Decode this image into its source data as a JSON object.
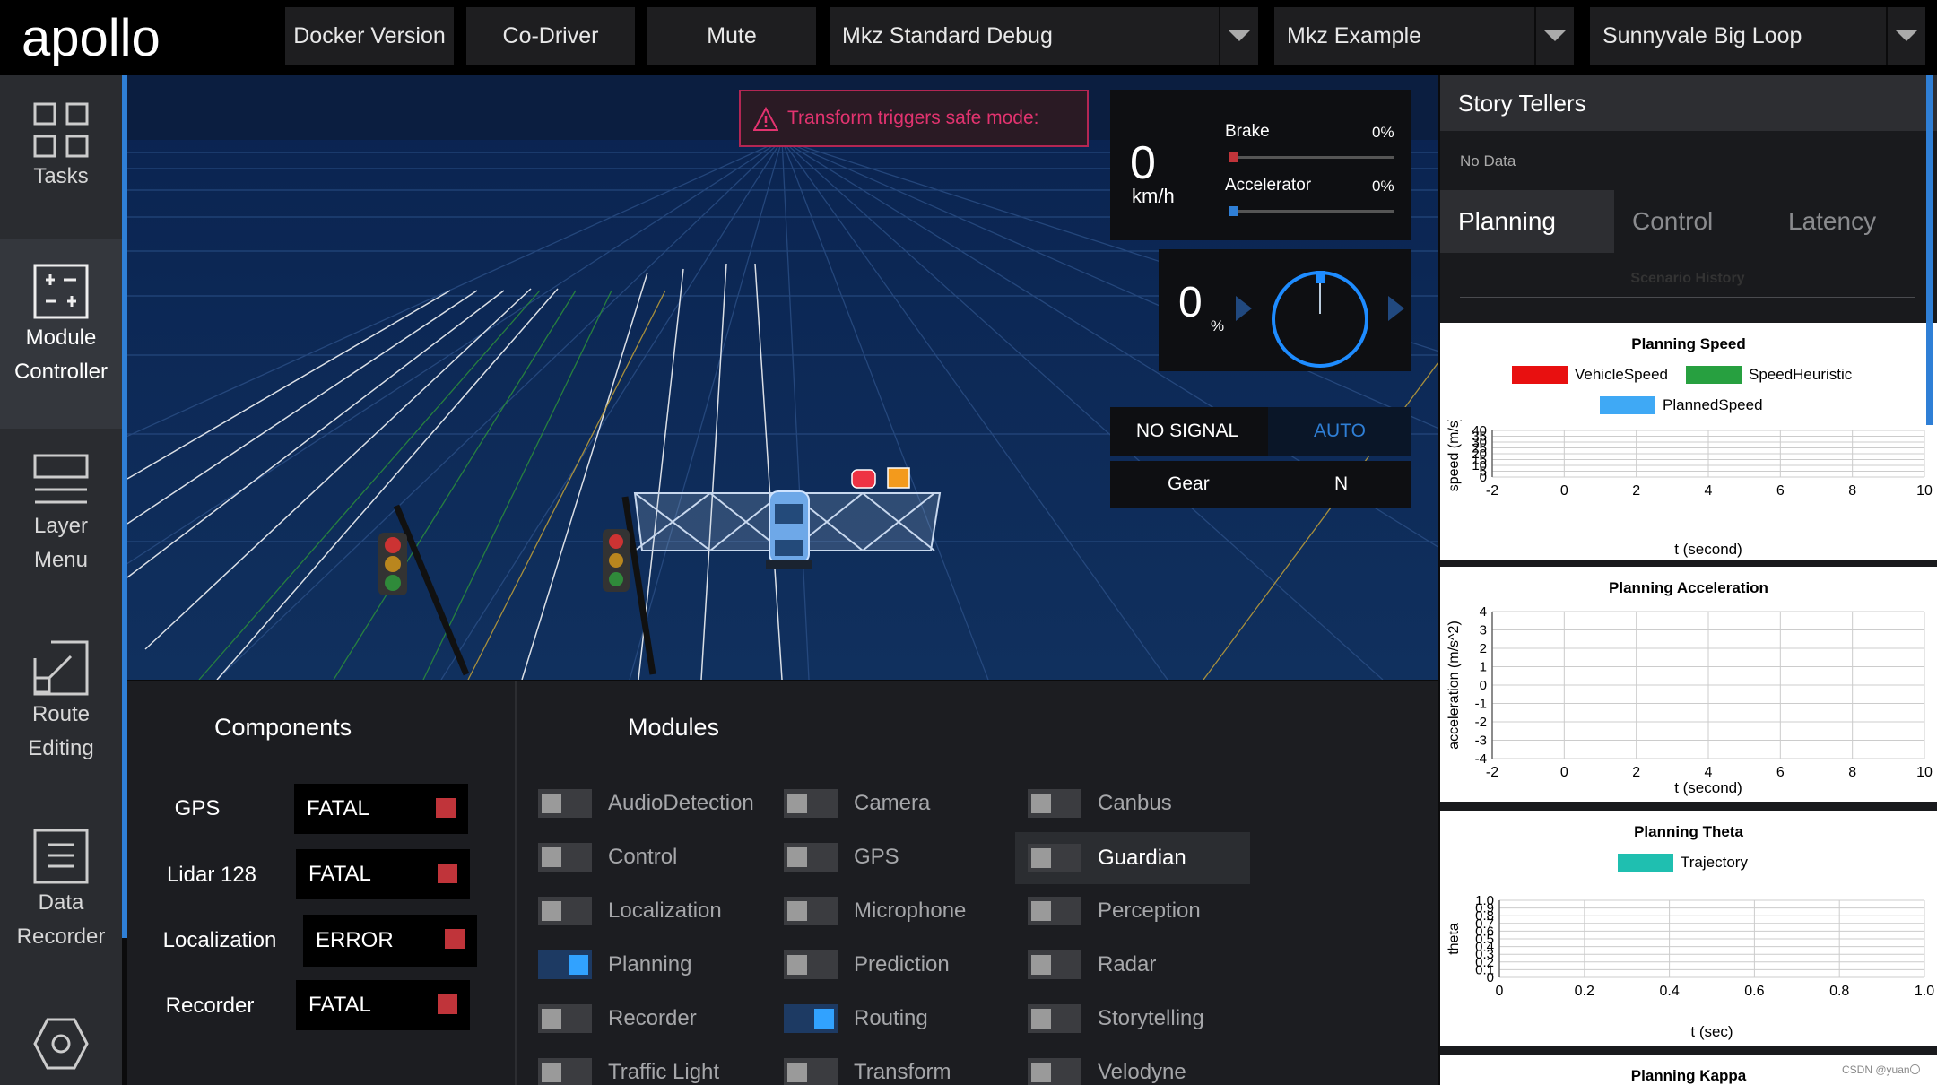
{
  "app": {
    "logo": "apollo"
  },
  "topbar": {
    "docker_label": "Docker Version",
    "codriver_label": "Co-Driver",
    "mute_label": "Mute",
    "mode_select": "Mkz Standard Debug",
    "vehicle_select": "Mkz Example",
    "map_select": "Sunnyvale Big Loop"
  },
  "sidenav": {
    "items": [
      {
        "label": "Tasks",
        "icon": "grid-icon"
      },
      {
        "label": "Module\nController",
        "icon": "sliders-icon"
      },
      {
        "label": "Layer\nMenu",
        "icon": "layers-icon"
      },
      {
        "label": "Route\nEditing",
        "icon": "route-icon"
      },
      {
        "label": "Data\nRecorder",
        "icon": "document-icon"
      },
      {
        "label": "",
        "icon": "hexagon-icon"
      }
    ]
  },
  "alert": {
    "text": "Transform triggers safe mode:"
  },
  "dashboard": {
    "speed": "0",
    "speed_unit": "km/h",
    "brake_label": "Brake",
    "brake_value": "0%",
    "brake_fraction": 0,
    "accel_label": "Accelerator",
    "accel_value": "0%",
    "accel_fraction": 0,
    "steering": "0",
    "steering_unit": "%",
    "signal": "NO SIGNAL",
    "mode": "AUTO",
    "gear_label": "Gear",
    "gear_value": "N"
  },
  "components": {
    "title": "Components",
    "items": [
      {
        "name": "GPS",
        "status": "FATAL"
      },
      {
        "name": "Lidar 128",
        "status": "FATAL"
      },
      {
        "name": "Localization",
        "status": "ERROR"
      },
      {
        "name": "Recorder",
        "status": "FATAL"
      }
    ]
  },
  "modules": {
    "title": "Modules",
    "col1": [
      {
        "name": "AudioDetection",
        "on": false
      },
      {
        "name": "Control",
        "on": false
      },
      {
        "name": "Localization",
        "on": false
      },
      {
        "name": "Planning",
        "on": true
      },
      {
        "name": "Recorder",
        "on": false
      },
      {
        "name": "Traffic Light",
        "on": false
      }
    ],
    "col2": [
      {
        "name": "Camera",
        "on": false
      },
      {
        "name": "GPS",
        "on": false
      },
      {
        "name": "Microphone",
        "on": false
      },
      {
        "name": "Prediction",
        "on": false
      },
      {
        "name": "Routing",
        "on": true
      },
      {
        "name": "Transform",
        "on": false
      }
    ],
    "col3": [
      {
        "name": "Canbus",
        "on": false
      },
      {
        "name": "Guardian",
        "on": false
      },
      {
        "name": "Perception",
        "on": false
      },
      {
        "name": "Radar",
        "on": false
      },
      {
        "name": "Storytelling",
        "on": false
      },
      {
        "name": "Velodyne",
        "on": false
      }
    ]
  },
  "right": {
    "header": "Story Tellers",
    "nodata": "No Data",
    "tabs": [
      "Planning",
      "Control",
      "Latency"
    ],
    "scenario_history": "Scenario History",
    "footer": "CSDN @yuan〇"
  },
  "chart_data": [
    {
      "type": "line",
      "title": "Planning Speed",
      "xlabel": "t (second)",
      "ylabel": "speed (m/s)",
      "xlim": [
        -2,
        10
      ],
      "ylim": [
        0,
        40
      ],
      "x_ticks": [
        "-2",
        "0",
        "2",
        "4",
        "6",
        "8",
        "10"
      ],
      "y_ticks": [
        "0",
        "5",
        "10",
        "15",
        "20",
        "25",
        "30",
        "35",
        "40"
      ],
      "series": [
        {
          "name": "VehicleSpeed",
          "color": "#e81010",
          "values": []
        },
        {
          "name": "SpeedHeuristic",
          "color": "#27a040",
          "values": []
        },
        {
          "name": "PlannedSpeed",
          "color": "#3fa9f5",
          "values": []
        }
      ]
    },
    {
      "type": "line",
      "title": "Planning Acceleration",
      "xlabel": "t (second)",
      "ylabel": "acceleration (m/s^2)",
      "xlim": [
        -2,
        10
      ],
      "ylim": [
        -4,
        4
      ],
      "x_ticks": [
        "-2",
        "0",
        "2",
        "4",
        "6",
        "8",
        "10"
      ],
      "y_ticks": [
        "-4",
        "-3",
        "-2",
        "-1",
        "0",
        "1",
        "2",
        "3",
        "4"
      ],
      "series": []
    },
    {
      "type": "line",
      "title": "Planning Theta",
      "xlabel": "t (sec)",
      "ylabel": "theta",
      "xlim": [
        0,
        1.0
      ],
      "ylim": [
        0,
        1.0
      ],
      "x_ticks": [
        "0",
        "0.2",
        "0.4",
        "0.6",
        "0.8",
        "1.0"
      ],
      "y_ticks": [
        "0",
        "0.1",
        "0.2",
        "0.3",
        "0.4",
        "0.5",
        "0.6",
        "0.7",
        "0.8",
        "0.9",
        "1.0"
      ],
      "series": [
        {
          "name": "Trajectory",
          "color": "#1fbfb0",
          "values": []
        }
      ]
    },
    {
      "type": "line",
      "title": "Planning Kappa",
      "series": []
    }
  ]
}
